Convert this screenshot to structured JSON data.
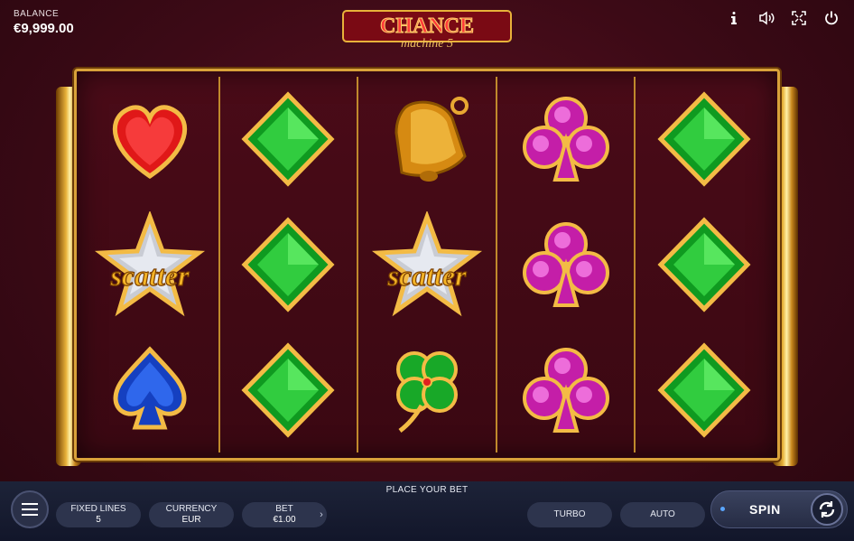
{
  "balance": {
    "label": "BALANCE",
    "value": "€9,999.00"
  },
  "logo": {
    "line1": "CHANCE",
    "line2": "machine 5"
  },
  "top_icons": [
    "info-icon",
    "sound-icon",
    "fullscreen-icon",
    "power-icon"
  ],
  "reels": [
    [
      "heart",
      "scatter",
      "spade"
    ],
    [
      "diamond",
      "diamond",
      "diamond"
    ],
    [
      "bell",
      "scatter",
      "clover"
    ],
    [
      "club",
      "club",
      "club"
    ],
    [
      "diamond",
      "diamond",
      "diamond"
    ]
  ],
  "scatter_text": "scatter",
  "bottom": {
    "place_bet": "PLACE YOUR BET",
    "fixed_lines": {
      "label": "FIXED LINES",
      "value": "5"
    },
    "currency": {
      "label": "CURRENCY",
      "value": "EUR"
    },
    "bet": {
      "label": "BET",
      "value": "€1.00"
    },
    "turbo": "TURBO",
    "auto": "AUTO",
    "spin": "SPIN"
  },
  "colors": {
    "gold": "#d9a23a",
    "background": "#3c0a16",
    "bar": "#12162a",
    "spin_dot": "#5aa6ff"
  }
}
